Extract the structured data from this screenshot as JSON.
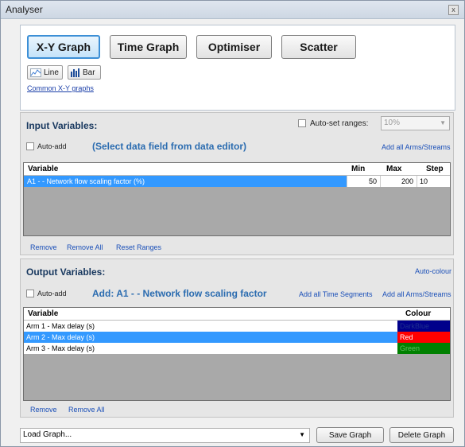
{
  "window": {
    "title": "Analyser",
    "close_glyph": "x"
  },
  "graph_types": [
    "X-Y Graph",
    "Time Graph",
    "Optimiser",
    "Scatter"
  ],
  "chart_styles": {
    "line": "Line",
    "bar": "Bar"
  },
  "common_link": "Common X-Y graphs",
  "input": {
    "title": "Input Variables:",
    "auto_set_label": "Auto-set ranges:",
    "range_value": "10%",
    "auto_add_label": "Auto-add",
    "prompt": "(Select data field from data editor)",
    "add_all": "Add all Arms/Streams",
    "columns": {
      "variable": "Variable",
      "min": "Min",
      "max": "Max",
      "step": "Step"
    },
    "rows": [
      {
        "variable": "A1 -   - Network flow scaling factor (%)",
        "min": "50",
        "max": "200",
        "step": "10"
      }
    ],
    "actions": {
      "remove": "Remove",
      "remove_all": "Remove All",
      "reset": "Reset Ranges"
    }
  },
  "output": {
    "title": "Output Variables:",
    "auto_colour": "Auto-colour",
    "auto_add_label": "Auto-add",
    "prompt": "Add: A1 -   - Network flow scaling factor",
    "add_time_segments": "Add all Time Segments",
    "add_all": "Add all Arms/Streams",
    "columns": {
      "variable": "Variable",
      "colour": "Colour"
    },
    "rows": [
      {
        "variable": "Arm 1 - Max delay (s)",
        "colour_name": "DarkBlue",
        "colour_hex": "#00008b",
        "text_hex": "#1e2f8f"
      },
      {
        "variable": "Arm 2 - Max delay (s)",
        "colour_name": "Red",
        "colour_hex": "#ff0000",
        "text_hex": "#ffffff"
      },
      {
        "variable": "Arm 3 - Max delay (s)",
        "colour_name": "Green",
        "colour_hex": "#008000",
        "text_hex": "#5fbf5f"
      }
    ],
    "actions": {
      "remove": "Remove",
      "remove_all": "Remove All"
    }
  },
  "footer": {
    "load_graph": "Load Graph...",
    "save_graph": "Save Graph",
    "delete_graph": "Delete Graph"
  },
  "colors": {
    "selection": "#3399ff",
    "title_blue": "#17375e",
    "link_blue": "#1a4fb8"
  }
}
